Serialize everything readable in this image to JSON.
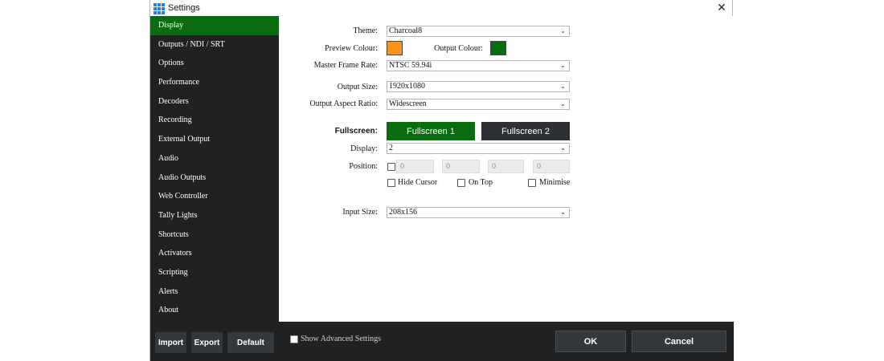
{
  "window": {
    "title": "Settings",
    "close_glyph": "✕"
  },
  "app_icon_colors": [
    "#2a7de1",
    "#2a7de1",
    "#2a7de1",
    "#2a7de1",
    "#2a7de1",
    "#2a7de1",
    "#2a7de1",
    "#2a7de1",
    "#2a7de1"
  ],
  "sidebar": {
    "items": [
      {
        "label": "Display",
        "active": true
      },
      {
        "label": "Outputs / NDI / SRT"
      },
      {
        "label": "Options"
      },
      {
        "label": "Performance"
      },
      {
        "label": "Decoders"
      },
      {
        "label": "Recording"
      },
      {
        "label": "External Output"
      },
      {
        "label": "Audio"
      },
      {
        "label": "Audio Outputs"
      },
      {
        "label": "Web Controller"
      },
      {
        "label": "Tally Lights"
      },
      {
        "label": "Shortcuts"
      },
      {
        "label": "Activators"
      },
      {
        "label": "Scripting"
      },
      {
        "label": "Alerts"
      },
      {
        "label": "About"
      }
    ],
    "buttons": {
      "import": "Import",
      "export": "Export",
      "default": "Default"
    }
  },
  "display": {
    "theme": {
      "label": "Theme:",
      "value": "Charcoal8"
    },
    "preview_colour": {
      "label": "Preview Colour:",
      "color": "#f7941d"
    },
    "output_colour": {
      "label": "Output Colour:",
      "color": "#0a6b10"
    },
    "master_frame_rate": {
      "label": "Master Frame Rate:",
      "value": "NTSC 59.94i"
    },
    "output_size": {
      "label": "Output Size:",
      "value": "1920x1080"
    },
    "output_aspect_ratio": {
      "label": "Output Aspect Ratio:",
      "value": "Widescreen"
    },
    "fullscreen": {
      "label": "Fullscreen:",
      "button1": "Fullscreen 1",
      "button2": "Fullscreen 2",
      "button1_color": "#0a6b10",
      "button2_color": "#2d3035"
    },
    "display_select": {
      "label": "Display:",
      "value": "2"
    },
    "position": {
      "label": "Position:",
      "values": [
        "0",
        "0",
        "0",
        "0"
      ]
    },
    "hide_cursor": "Hide Cursor",
    "on_top": "On Top",
    "minimise": "Minimise",
    "input_size": {
      "label": "Input Size:",
      "value": "208x156"
    }
  },
  "footer": {
    "show_advanced": "Show Advanced Settings",
    "ok": "OK",
    "cancel": "Cancel"
  }
}
